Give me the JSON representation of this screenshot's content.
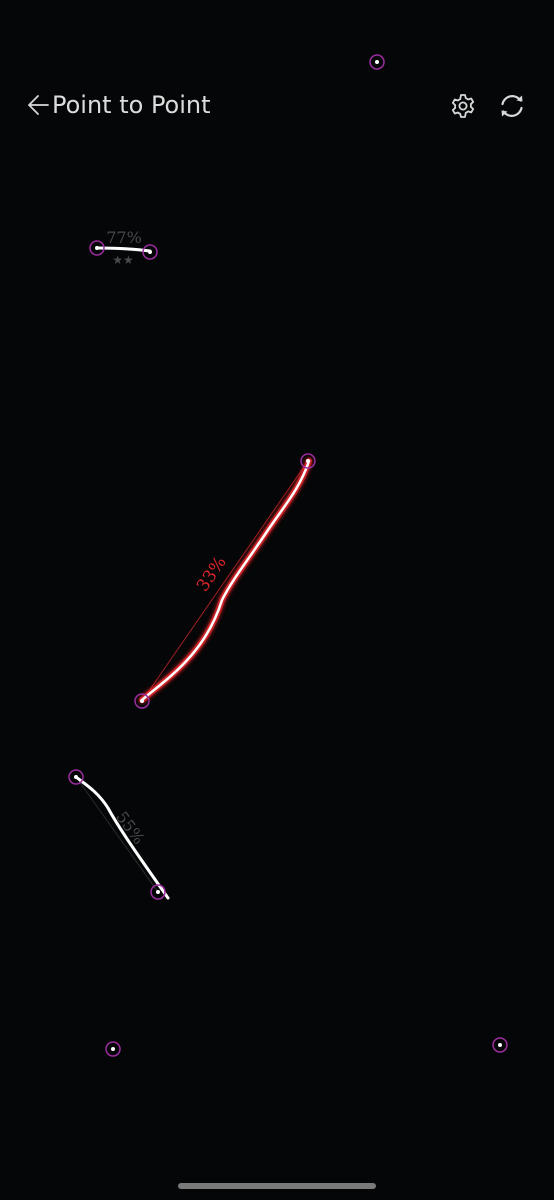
{
  "header": {
    "title": "Point to Point",
    "back_icon": "back-arrow-icon",
    "settings_icon": "gear-icon",
    "refresh_icon": "refresh-icon"
  },
  "colors": {
    "background": "#050607",
    "point_ring": "#9a2d9f",
    "point_center": "#ffffff",
    "stroke_white": "#ffffff",
    "highlight_red": "#e0262b",
    "muted_label": "#4a4a4a"
  },
  "game": {
    "drawn_lines": [
      {
        "score": "77%",
        "stars": "★★"
      },
      {
        "score": "33%",
        "stars": ""
      },
      {
        "score": "55%",
        "stars": ""
      }
    ]
  }
}
